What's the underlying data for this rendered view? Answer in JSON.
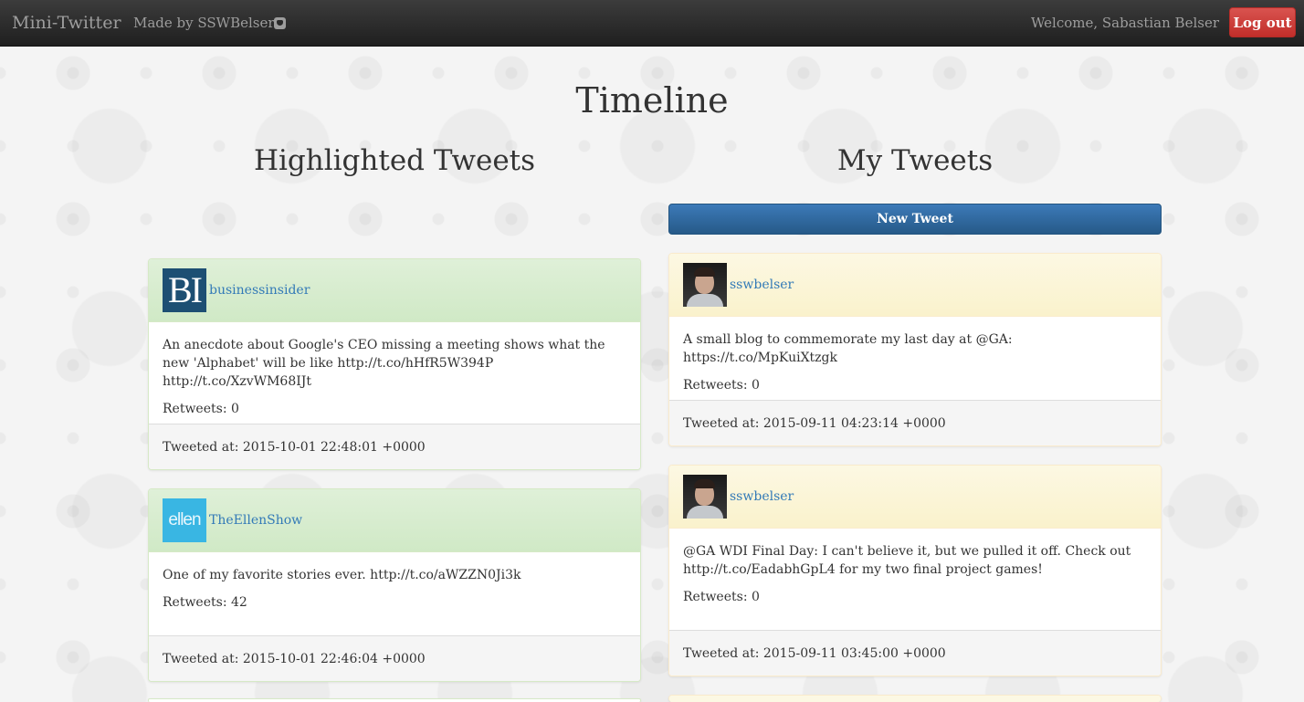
{
  "navbar": {
    "brand": "Mini-Twitter",
    "made_by": "Made by SSWBelser",
    "github_icon": "github-icon",
    "welcome": "Welcome, Sabastian Belser",
    "logout_label": "Log out"
  },
  "page": {
    "title": "Timeline"
  },
  "highlighted": {
    "title": "Highlighted Tweets",
    "tweets": [
      {
        "avatar_text": "BI",
        "handle": "businessinsider",
        "text": "An anecdote about Google's CEO missing a meeting shows what the new 'Alphabet' will be like http://t.co/hHfR5W394P http://t.co/XzvWM68IJt",
        "retweets": "Retweets: 0",
        "tweeted_at": "Tweeted at: 2015-10-01 22:48:01 +0000"
      },
      {
        "avatar_text": "ellen",
        "handle": "TheEllenShow",
        "text": "One of my favorite stories ever. http://t.co/aWZZN0Ji3k",
        "retweets": "Retweets: 42",
        "tweeted_at": "Tweeted at: 2015-10-01 22:46:04 +0000"
      }
    ]
  },
  "mine": {
    "title": "My Tweets",
    "new_tweet_label": "New Tweet",
    "tweets": [
      {
        "handle": "sswbelser",
        "text": "A small blog to commemorate my last day at @GA: https://t.co/MpKuiXtzgk",
        "retweets": "Retweets: 0",
        "tweeted_at": "Tweeted at: 2015-09-11 04:23:14 +0000"
      },
      {
        "handle": "sswbelser",
        "text": "@GA WDI Final Day: I can't believe it, but we pulled it off. Check out http://t.co/EadabhGpL4 for my two final project games!",
        "retweets": "Retweets: 0",
        "tweeted_at": "Tweeted at: 2015-09-11 03:45:00 +0000"
      }
    ]
  },
  "colors": {
    "navbar": "#222222",
    "logout": "#d9534f",
    "primary": "#337ab7",
    "highlight_header": "#dff0d8",
    "mine_header": "#fcf8e3"
  }
}
